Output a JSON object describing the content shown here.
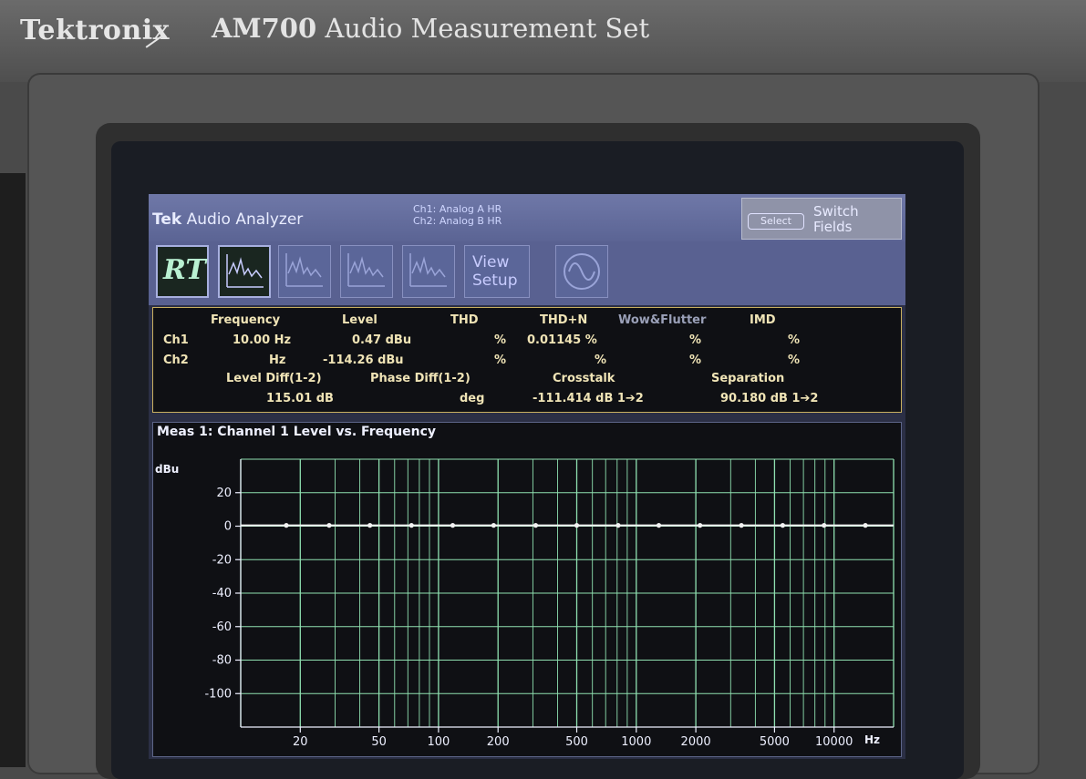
{
  "device": {
    "brand": "Tektronix",
    "model": "AM700",
    "model_desc": "Audio Measurement Set"
  },
  "app": {
    "tek": "Tek",
    "title": "Audio Analyzer",
    "ch1_info": "Ch1: Analog A HR",
    "ch2_info": "Ch2: Analog B HR",
    "select_label": "Select",
    "switch_label_1": "Switch",
    "switch_label_2": "Fields"
  },
  "toolbar": {
    "rt_label": "RT",
    "view_label_1": "View",
    "view_label_2": "Setup"
  },
  "readings": {
    "headers": {
      "frequency": "Frequency",
      "level": "Level",
      "thd": "THD",
      "thdn": "THD+N",
      "wow": "Wow&Flutter",
      "imd": "IMD"
    },
    "ch1": {
      "label": "Ch1",
      "frequency": "10.00 Hz",
      "level": "0.47 dBu",
      "thd": "%",
      "thdn": "0.01145 %",
      "wow": "%",
      "imd": "%"
    },
    "ch2": {
      "label": "Ch2",
      "frequency": "Hz",
      "level": "-114.26 dBu",
      "thd": "%",
      "thdn": "%",
      "wow": "%",
      "imd": "%"
    },
    "sub_headers": {
      "level_diff": "Level Diff(1-2)",
      "phase_diff": "Phase Diff(1-2)",
      "crosstalk": "Crosstalk",
      "separation": "Separation"
    },
    "sub_values": {
      "level_diff": "115.01 dB",
      "phase_diff": "deg",
      "crosstalk": "-111.414 dB 1➔2",
      "separation": "90.180 dB 1➔2"
    }
  },
  "colors": {
    "grid": "#8fe0b0",
    "trace": "#f2f2f2",
    "axis_text": "#eef0ff"
  },
  "chart_data": {
    "type": "line",
    "title": "Meas 1: Channel 1 Level vs. Frequency",
    "ylabel": "dBu",
    "xlabel": "Hz",
    "x_scale": "log",
    "xlim": [
      10,
      20000
    ],
    "ylim": [
      -120,
      40
    ],
    "grid": true,
    "y_ticks": [
      20,
      0,
      -20,
      -40,
      -60,
      -80,
      -100
    ],
    "y_tick_labels": [
      "20",
      "0",
      "-20",
      "-40",
      "-60",
      "-80",
      "-100"
    ],
    "x_ticks": [
      20,
      50,
      100,
      200,
      500,
      1000,
      2000,
      5000,
      10000
    ],
    "x_tick_labels": [
      "20",
      "50",
      "100",
      "200",
      "500",
      "1000",
      "2000",
      "5000",
      "10000"
    ],
    "series": [
      {
        "x": [
          17,
          28,
          45,
          73,
          118,
          190,
          310,
          500,
          810,
          1300,
          2100,
          3400,
          5500,
          8900,
          14400
        ],
        "y": [
          0.47,
          0.47,
          0.47,
          0.47,
          0.47,
          0.47,
          0.47,
          0.47,
          0.47,
          0.47,
          0.47,
          0.47,
          0.47,
          0.47,
          0.47
        ]
      }
    ]
  }
}
